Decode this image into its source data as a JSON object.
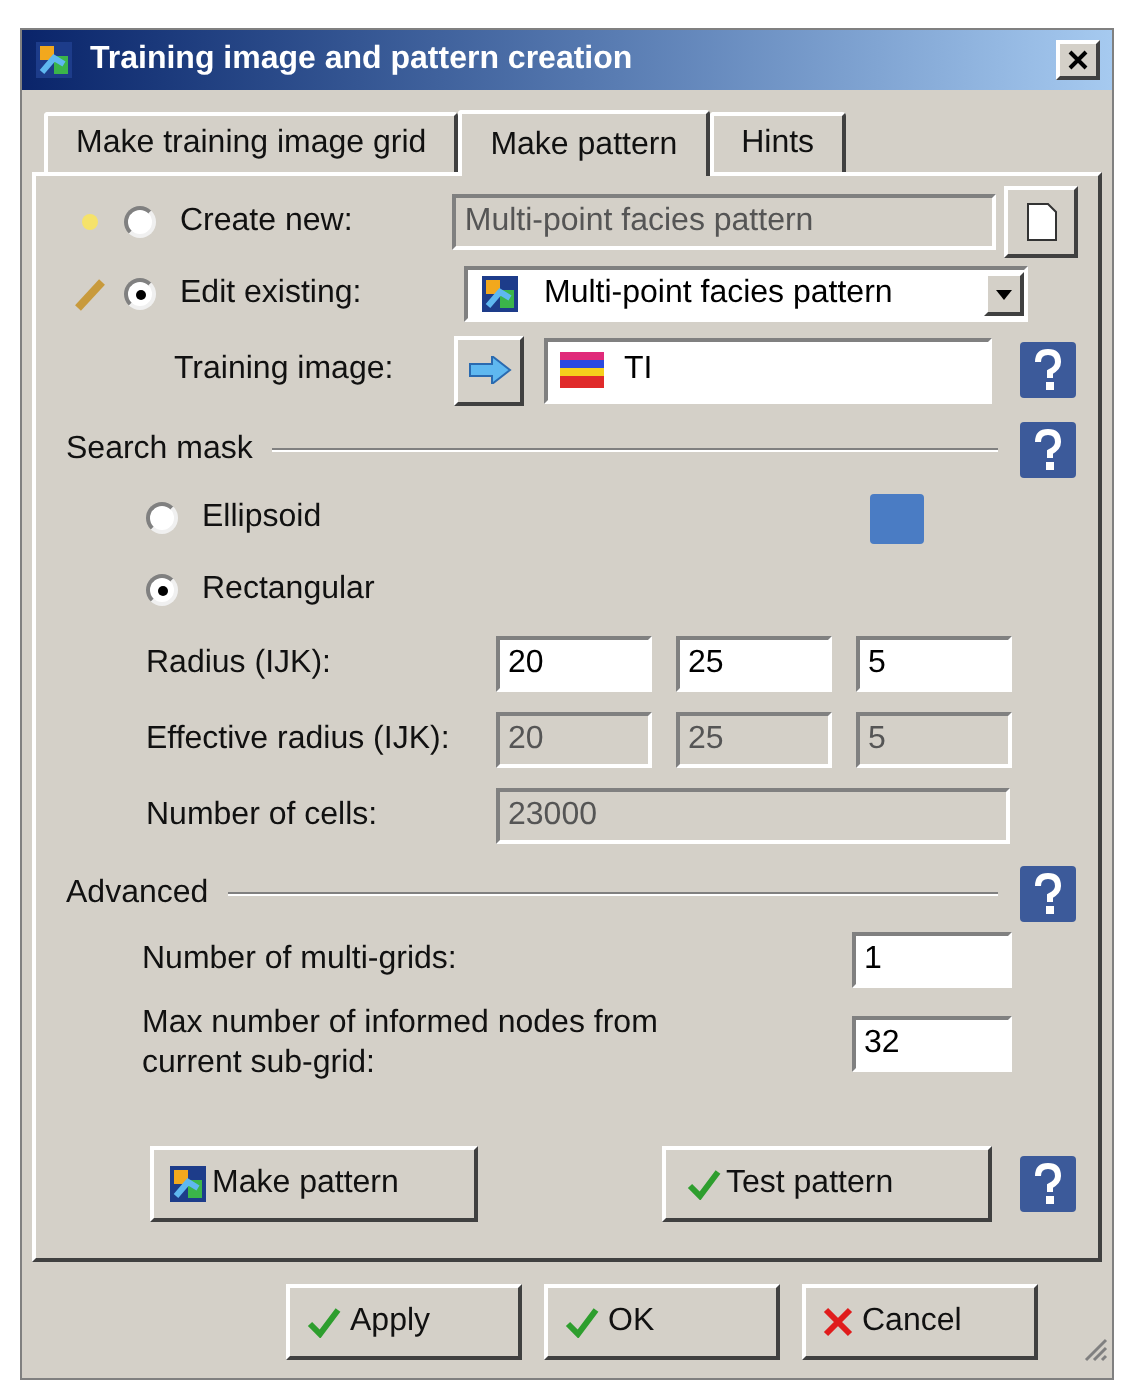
{
  "window": {
    "title": "Training image and pattern creation"
  },
  "tabs": [
    {
      "label": "Make training image grid",
      "selected": false
    },
    {
      "label": "Make pattern",
      "selected": true
    },
    {
      "label": "Hints",
      "selected": false
    }
  ],
  "pattern_source": {
    "create_new": {
      "label": "Create new:",
      "selected": false,
      "value": "Multi-point facies pattern",
      "disabled": true
    },
    "edit_existing": {
      "label": "Edit existing:",
      "selected": true,
      "value": "Multi-point facies pattern"
    },
    "training_image": {
      "label": "Training image:",
      "value": "TI"
    }
  },
  "search_mask": {
    "title": "Search mask",
    "color": "#4a7cc4",
    "shapes": [
      {
        "label": "Ellipsoid",
        "selected": false
      },
      {
        "label": "Rectangular",
        "selected": true
      }
    ],
    "rows": [
      {
        "label": "Radius (IJK):",
        "disabled": false,
        "values": [
          "20",
          "25",
          "5"
        ]
      },
      {
        "label": "Effective radius (IJK):",
        "disabled": true,
        "values": [
          "20",
          "25",
          "5"
        ]
      },
      {
        "label": "Number of cells:",
        "disabled": true,
        "values": [
          "23000"
        ]
      }
    ]
  },
  "advanced": {
    "title": "Advanced",
    "rows": [
      {
        "label": "Number of multi-grids:",
        "value": "1"
      },
      {
        "label": "Max number of informed nodes from current sub-grid:",
        "value": "32"
      }
    ]
  },
  "actions": [
    {
      "kind": "make",
      "label": "Make pattern"
    },
    {
      "kind": "test",
      "label": "Test pattern"
    }
  ],
  "footer_buttons": [
    {
      "kind": "confirm",
      "label": "Apply"
    },
    {
      "kind": "confirm",
      "label": "OK"
    },
    {
      "kind": "cancel",
      "label": "Cancel"
    }
  ]
}
